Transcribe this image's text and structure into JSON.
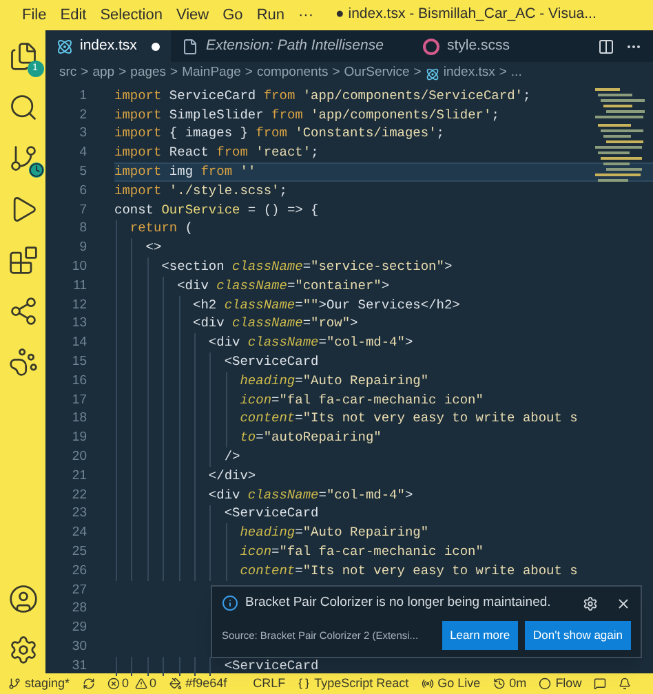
{
  "title_bar": {
    "menu": [
      "File",
      "Edit",
      "Selection",
      "View",
      "Go",
      "Run",
      "···"
    ],
    "title": "● index.tsx - Bismillah_Car_AC - Visua..."
  },
  "activity_bar": {
    "explorer_badge": "1"
  },
  "tabs": [
    {
      "label": "index.tsx",
      "kind": "react",
      "selected": true,
      "modified": true,
      "preview": false
    },
    {
      "label": "Extension: Path Intellisense",
      "kind": "doc",
      "selected": false,
      "modified": false,
      "preview": true
    },
    {
      "label": "style.scss",
      "kind": "sass",
      "selected": false,
      "modified": false,
      "preview": false
    }
  ],
  "breadcrumb": {
    "separator": ">",
    "items": [
      "src",
      "app",
      "pages",
      "MainPage",
      "components",
      "OurService",
      "index.tsx",
      "..."
    ]
  },
  "editor": {
    "lines": [
      {
        "number": "1",
        "current": false,
        "tokens": [
          {
            "kind": "keyword",
            "text": "import"
          },
          {
            "kind": "plain",
            "text": " ServiceCard "
          },
          {
            "kind": "keyword",
            "text": "from"
          },
          {
            "kind": "string",
            "text": " 'app/components/ServiceCard'"
          },
          {
            "kind": "plain",
            "text": ";"
          }
        ]
      },
      {
        "number": "2",
        "current": false,
        "tokens": [
          {
            "kind": "keyword",
            "text": "import"
          },
          {
            "kind": "plain",
            "text": " SimpleSlider "
          },
          {
            "kind": "keyword",
            "text": "from"
          },
          {
            "kind": "string",
            "text": " 'app/components/Slider'"
          },
          {
            "kind": "plain",
            "text": ";"
          }
        ]
      },
      {
        "number": "3",
        "current": false,
        "tokens": [
          {
            "kind": "keyword",
            "text": "import"
          },
          {
            "kind": "plain",
            "text": " { images } "
          },
          {
            "kind": "keyword",
            "text": "from"
          },
          {
            "kind": "string",
            "text": " 'Constants/images'"
          },
          {
            "kind": "plain",
            "text": ";"
          }
        ]
      },
      {
        "number": "4",
        "current": false,
        "tokens": [
          {
            "kind": "keyword",
            "text": "import"
          },
          {
            "kind": "plain",
            "text": " React "
          },
          {
            "kind": "keyword",
            "text": "from"
          },
          {
            "kind": "string",
            "text": " 'react'"
          },
          {
            "kind": "plain",
            "text": ";"
          }
        ]
      },
      {
        "number": "5",
        "current": true,
        "tokens": [
          {
            "kind": "keyword",
            "text": "import"
          },
          {
            "kind": "plain",
            "text": " img "
          },
          {
            "kind": "keyword",
            "text": "from"
          },
          {
            "kind": "string",
            "text": " ''"
          }
        ]
      },
      {
        "number": "6",
        "current": false,
        "tokens": [
          {
            "kind": "keyword",
            "text": "import"
          },
          {
            "kind": "string",
            "text": " './style.scss'"
          },
          {
            "kind": "plain",
            "text": ";"
          }
        ]
      },
      {
        "number": "7",
        "current": false,
        "tokens": [
          {
            "kind": "plain",
            "text": "const "
          },
          {
            "kind": "name",
            "text": "OurService"
          },
          {
            "kind": "plain",
            "text": " = () => {"
          }
        ]
      },
      {
        "number": "8",
        "current": false,
        "tokens": [
          {
            "kind": "keyword",
            "text": "  return"
          },
          {
            "kind": "plain",
            "text": " ("
          }
        ]
      },
      {
        "number": "9",
        "current": false,
        "tokens": [
          {
            "kind": "plain",
            "text": "    <>"
          }
        ]
      },
      {
        "number": "10",
        "current": false,
        "tokens": [
          {
            "kind": "plain",
            "text": "      <section "
          },
          {
            "kind": "attribute",
            "text": "className"
          },
          {
            "kind": "plain",
            "text": "="
          },
          {
            "kind": "string",
            "text": "\"service-section\""
          },
          {
            "kind": "plain",
            "text": ">"
          }
        ]
      },
      {
        "number": "11",
        "current": false,
        "tokens": [
          {
            "kind": "plain",
            "text": "        <div "
          },
          {
            "kind": "attribute",
            "text": "className"
          },
          {
            "kind": "plain",
            "text": "="
          },
          {
            "kind": "string",
            "text": "\"container\""
          },
          {
            "kind": "plain",
            "text": ">"
          }
        ]
      },
      {
        "number": "12",
        "current": false,
        "tokens": [
          {
            "kind": "plain",
            "text": "          <h2 "
          },
          {
            "kind": "attribute",
            "text": "className"
          },
          {
            "kind": "plain",
            "text": "="
          },
          {
            "kind": "string",
            "text": "\"\""
          },
          {
            "kind": "plain",
            "text": ">Our Services</h2>"
          }
        ]
      },
      {
        "number": "13",
        "current": false,
        "tokens": [
          {
            "kind": "plain",
            "text": "          <div "
          },
          {
            "kind": "attribute",
            "text": "className"
          },
          {
            "kind": "plain",
            "text": "="
          },
          {
            "kind": "string",
            "text": "\"row\""
          },
          {
            "kind": "plain",
            "text": ">"
          }
        ]
      },
      {
        "number": "14",
        "current": false,
        "tokens": [
          {
            "kind": "plain",
            "text": "            <div "
          },
          {
            "kind": "attribute",
            "text": "className"
          },
          {
            "kind": "plain",
            "text": "="
          },
          {
            "kind": "string",
            "text": "\"col-md-4\""
          },
          {
            "kind": "plain",
            "text": ">"
          }
        ]
      },
      {
        "number": "15",
        "current": false,
        "tokens": [
          {
            "kind": "plain",
            "text": "              <ServiceCard"
          }
        ]
      },
      {
        "number": "16",
        "current": false,
        "tokens": [
          {
            "kind": "attribute",
            "text": "                heading"
          },
          {
            "kind": "plain",
            "text": "="
          },
          {
            "kind": "string",
            "text": "\"Auto Repairing\""
          }
        ]
      },
      {
        "number": "17",
        "current": false,
        "tokens": [
          {
            "kind": "attribute",
            "text": "                icon"
          },
          {
            "kind": "plain",
            "text": "="
          },
          {
            "kind": "string",
            "text": "\"fal fa-car-mechanic icon\""
          }
        ]
      },
      {
        "number": "18",
        "current": false,
        "tokens": [
          {
            "kind": "attribute",
            "text": "                content"
          },
          {
            "kind": "plain",
            "text": "="
          },
          {
            "kind": "string",
            "text": "\"Its not very easy to write about s"
          }
        ]
      },
      {
        "number": "19",
        "current": false,
        "tokens": [
          {
            "kind": "attribute",
            "text": "                to"
          },
          {
            "kind": "plain",
            "text": "="
          },
          {
            "kind": "string",
            "text": "\"autoRepairing\""
          }
        ]
      },
      {
        "number": "20",
        "current": false,
        "tokens": [
          {
            "kind": "plain",
            "text": "              />"
          }
        ]
      },
      {
        "number": "21",
        "current": false,
        "tokens": [
          {
            "kind": "plain",
            "text": "            </div>"
          }
        ]
      },
      {
        "number": "22",
        "current": false,
        "tokens": [
          {
            "kind": "plain",
            "text": "            <div "
          },
          {
            "kind": "attribute",
            "text": "className"
          },
          {
            "kind": "plain",
            "text": "="
          },
          {
            "kind": "string",
            "text": "\"col-md-4\""
          },
          {
            "kind": "plain",
            "text": ">"
          }
        ]
      },
      {
        "number": "23",
        "current": false,
        "tokens": [
          {
            "kind": "plain",
            "text": "              <ServiceCard"
          }
        ]
      },
      {
        "number": "24",
        "current": false,
        "tokens": [
          {
            "kind": "attribute",
            "text": "                heading"
          },
          {
            "kind": "plain",
            "text": "="
          },
          {
            "kind": "string",
            "text": "\"Auto Repairing\""
          }
        ]
      },
      {
        "number": "25",
        "current": false,
        "tokens": [
          {
            "kind": "attribute",
            "text": "                icon"
          },
          {
            "kind": "plain",
            "text": "="
          },
          {
            "kind": "string",
            "text": "\"fal fa-car-mechanic icon\""
          }
        ]
      },
      {
        "number": "26",
        "current": false,
        "tokens": [
          {
            "kind": "attribute",
            "text": "                content"
          },
          {
            "kind": "plain",
            "text": "="
          },
          {
            "kind": "string",
            "text": "\"Its not very easy to write about s"
          }
        ]
      },
      {
        "number": "27",
        "current": false
      },
      {
        "number": "28",
        "current": false
      },
      {
        "number": "29",
        "current": false
      },
      {
        "number": "30",
        "current": false
      },
      {
        "number": "31",
        "current": false,
        "tokens": [
          {
            "kind": "plain",
            "text": "              <ServiceCard"
          }
        ]
      }
    ]
  },
  "notification": {
    "message": "Bracket Pair Colorizer is no longer being maintained.",
    "source": "Source: Bracket Pair Colorizer 2 (Extensi...",
    "buttons": [
      "Learn more",
      "Don't show again"
    ]
  },
  "status_bar": {
    "branch": "staging*",
    "errors": "0",
    "warnings": "0",
    "color": "#f9e64f",
    "line_ending": "CRLF",
    "language": "TypeScript React",
    "go_live": "Go Live",
    "timer": "0m",
    "flow": "Flow"
  }
}
